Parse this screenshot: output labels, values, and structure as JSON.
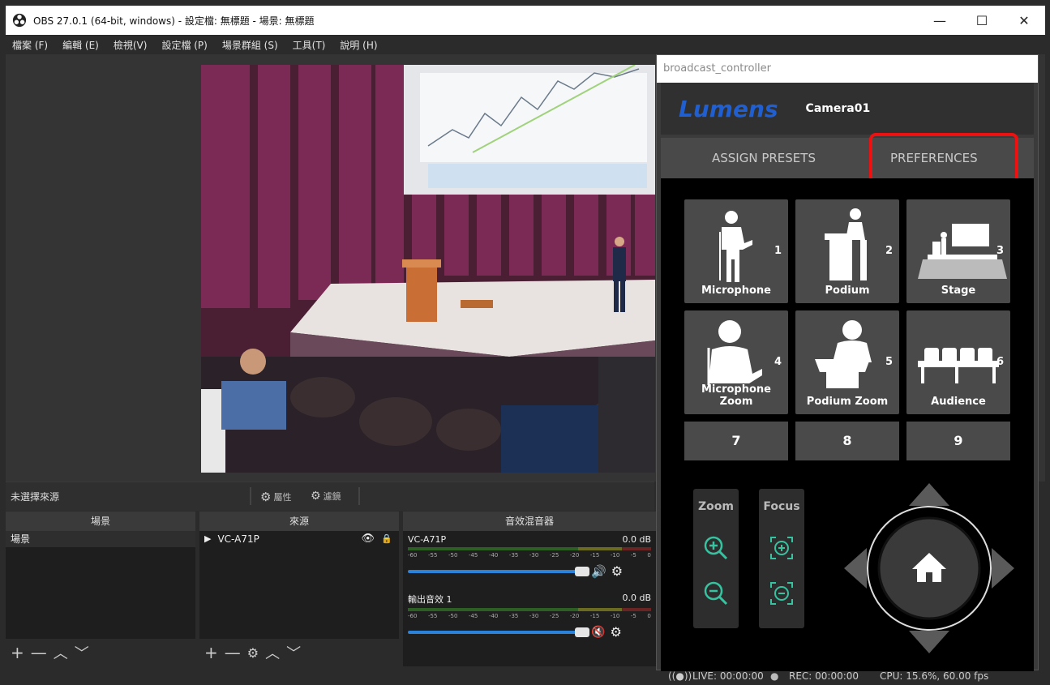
{
  "window": {
    "title": "OBS 27.0.1 (64-bit, windows) - 設定檔: 無標題 - 場景: 無標題",
    "minimize": "—",
    "maximize": "☐",
    "close": "✕"
  },
  "menu": [
    "檔案 (F)",
    "編輯 (E)",
    "檢視(V)",
    "設定檔 (P)",
    "場景群組 (S)",
    "工具(T)",
    "說明 (H)"
  ],
  "source_toolbar": {
    "no_source": "未選擇來源",
    "properties": "屬性",
    "filters": "濾鏡"
  },
  "scenes": {
    "header": "場景",
    "items": [
      "場景"
    ]
  },
  "sources": {
    "header": "來源",
    "items": [
      "VC-A71P"
    ]
  },
  "mixer": {
    "header": "音效混音器",
    "channels": [
      {
        "name": "VC-A71P",
        "db": "0.0 dB",
        "muted": false
      },
      {
        "name": "輸出音效 1",
        "db": "0.0 dB",
        "muted": true
      }
    ],
    "ticks": [
      "-60",
      "-55",
      "-50",
      "-45",
      "-40",
      "-35",
      "-30",
      "-25",
      "-20",
      "-15",
      "-10",
      "-5",
      "0"
    ]
  },
  "status": {
    "live": "LIVE: 00:00:00",
    "rec": "REC: 00:00:00",
    "cpu": "CPU: 15.6%, 60.00 fps"
  },
  "broadcast_controller": {
    "window_title": "broadcast_controller",
    "brand": "Lumens",
    "camera": "Camera01",
    "tabs": [
      "ASSIGN PRESETS",
      "PREFERENCES"
    ],
    "presets": [
      {
        "num": "1",
        "label": "Microphone"
      },
      {
        "num": "2",
        "label": "Podium"
      },
      {
        "num": "3",
        "label": "Stage"
      },
      {
        "num": "4",
        "label": "Microphone Zoom"
      },
      {
        "num": "5",
        "label": "Podium Zoom"
      },
      {
        "num": "6",
        "label": "Audience"
      }
    ],
    "extra_presets": [
      "7",
      "8",
      "9"
    ],
    "zoom_label": "Zoom",
    "focus_label": "Focus",
    "accent": "#1f5fd1",
    "highlight": "#e11111"
  }
}
